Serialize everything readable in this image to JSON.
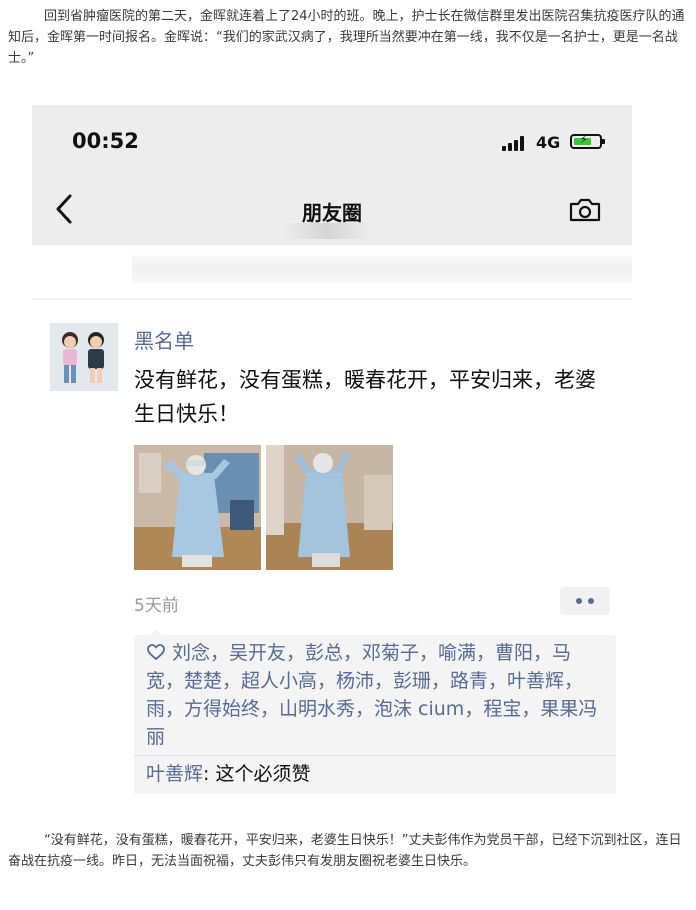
{
  "article": {
    "intro": "回到省肿瘤医院的第二天，金晖就连着上了24小时的班。晚上，护士长在微信群里发出医院召集抗疫医疗队的通知后，金晖第一时间报名。金晖说：“我们的家武汉病了，我理所当然要冲在第一线，我不仅是一名护士，更是一名战士。”",
    "outro": "“没有鲜花，没有蛋糕，暖春花开，平安归来，老婆生日快乐！”丈夫彭伟作为党员干部，已经下沉到社区，连日奋战在抗疫一线。昨日，无法当面祝福，丈夫彭伟只有发朋友圈祝老婆生日快乐。"
  },
  "phone": {
    "status": {
      "time": "00:52",
      "network": "4G",
      "battery_level": 0.6
    },
    "nav": {
      "title": "朋友圈",
      "back_icon": "chevron-left-icon",
      "camera_icon": "camera-icon"
    },
    "post": {
      "username": "黑名单",
      "text": "没有鲜花，没有蛋糕，暖春花开，平安归来，老婆生日快乐！",
      "photos": [
        "photo-1",
        "photo-2"
      ],
      "time_ago": "5天前",
      "more_icon": "ellipsis-icon",
      "likes": {
        "heart_icon": "heart-icon",
        "names": "刘念，吴开友，彭总，邓菊子，喻满，曹阳，马宽，楚楚，超人小高，杨沛，彭珊，路青，叶善辉，雨，方得始终，山明水秀，泡沫 cium，程宝，果果冯丽"
      },
      "comment": {
        "author": "叶善辉",
        "separator": ": ",
        "text": "这个必须赞"
      }
    }
  },
  "colors": {
    "link": "#576b95",
    "nav_bg": "#ededed",
    "likes_bg": "#f4f4f4",
    "battery": "#38c538"
  }
}
